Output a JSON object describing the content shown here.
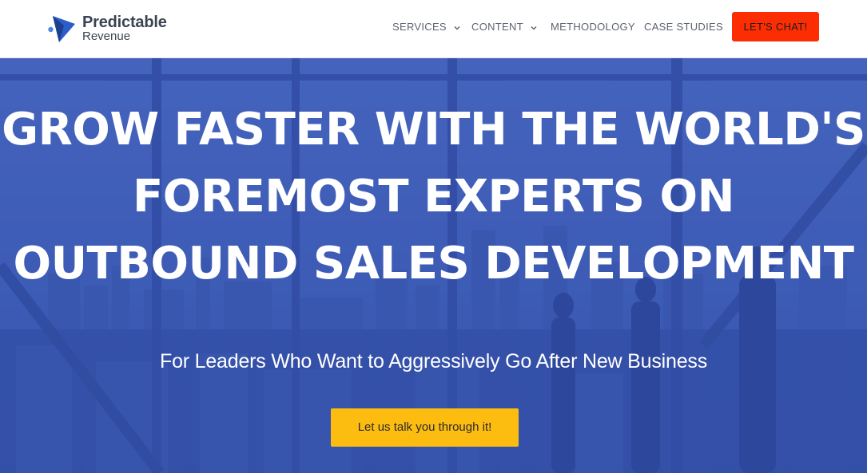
{
  "brand": {
    "name": "Predictable",
    "tagline": "Revenue",
    "logo_colors": [
      "#2b5ec9",
      "#1d3f8f",
      "#4f86e6"
    ]
  },
  "nav": {
    "items": [
      {
        "label": "SERVICES",
        "has_dropdown": true,
        "icon": "chevron-down-icon"
      },
      {
        "label": "CONTENT",
        "has_dropdown": true,
        "icon": "chevron-down-icon"
      },
      {
        "label": "METHODOLOGY",
        "has_dropdown": false
      },
      {
        "label": "CASE STUDIES",
        "has_dropdown": false
      }
    ],
    "cta_label": "LET'S CHAT!"
  },
  "hero": {
    "title": "GROW FASTER WITH THE WORLD'S FOREMOST EXPERTS ON OUTBOUND SALES DEVELOPMENT",
    "subtitle": "For Leaders Who Want to Aggressively Go After New Business",
    "button_label": "Let us talk you through it!",
    "background_description_icon": "city-skyline-office-photo"
  },
  "colors": {
    "hero_overlay": "#3c5bb6",
    "cta_red": "#fc2d02",
    "cta_yellow": "#fcbc10",
    "nav_text": "#5b6270"
  }
}
